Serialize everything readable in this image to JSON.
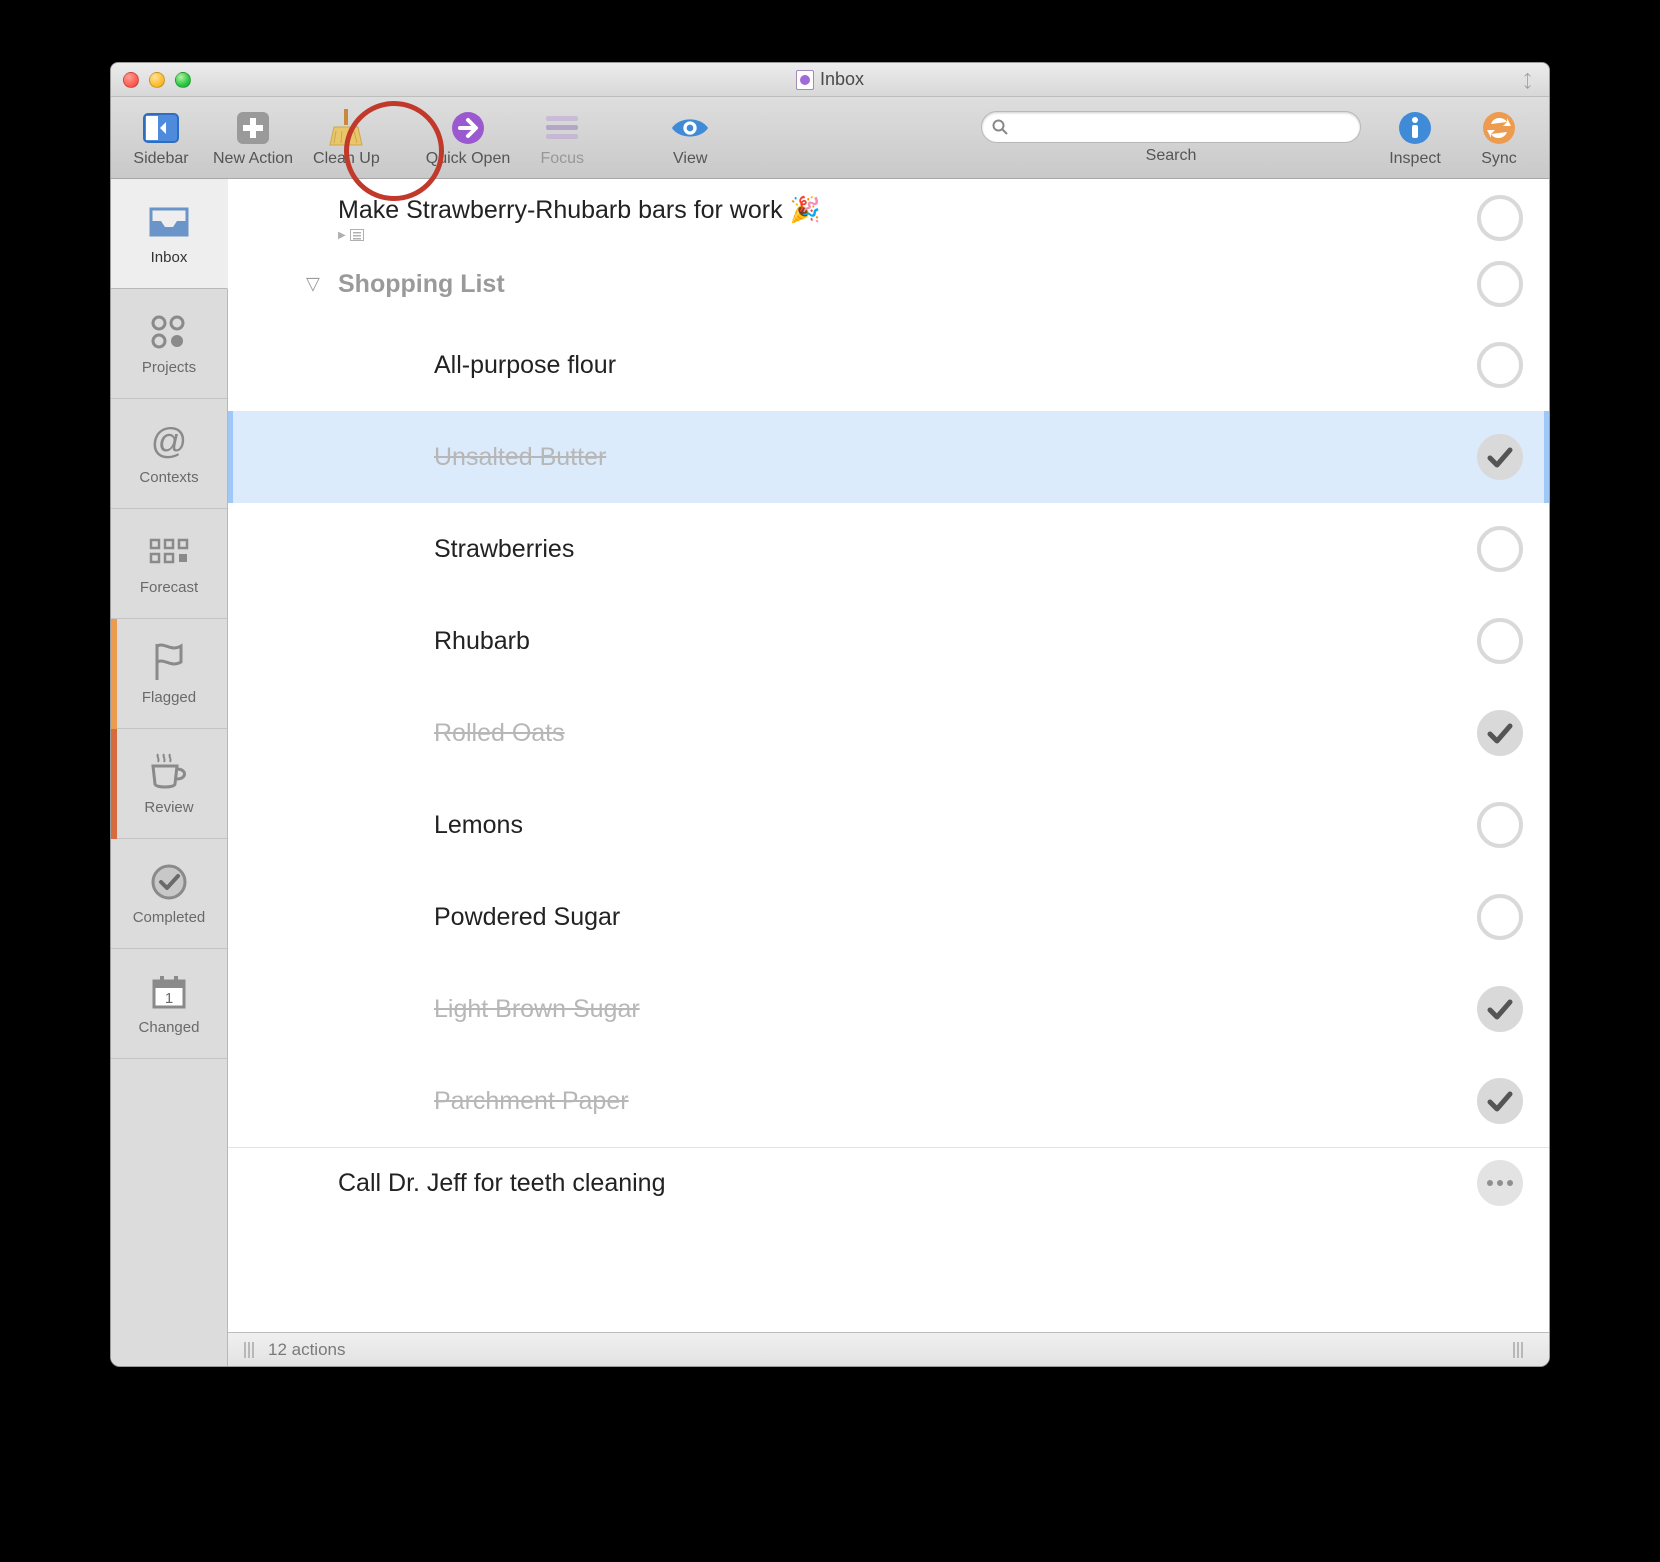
{
  "window": {
    "title": "Inbox"
  },
  "toolbar": {
    "sidebar": "Sidebar",
    "new_action": "New Action",
    "clean_up": "Clean Up",
    "quick_open": "Quick Open",
    "focus": "Focus",
    "view": "View",
    "search": "Search",
    "inspect": "Inspect",
    "sync": "Sync",
    "search_placeholder": ""
  },
  "sidebar": {
    "items": [
      {
        "label": "Inbox"
      },
      {
        "label": "Projects"
      },
      {
        "label": "Contexts"
      },
      {
        "label": "Forecast"
      },
      {
        "label": "Flagged"
      },
      {
        "label": "Review"
      },
      {
        "label": "Completed"
      },
      {
        "label": "Changed"
      }
    ]
  },
  "list": {
    "top_item": {
      "title": "Make Strawberry-Rhubarb bars for work 🎉"
    },
    "group": {
      "title": "Shopping List"
    },
    "items": [
      {
        "title": "All-purpose flour",
        "done": false
      },
      {
        "title": "Unsalted Butter",
        "done": true,
        "selected": true
      },
      {
        "title": "Strawberries",
        "done": false
      },
      {
        "title": "Rhubarb",
        "done": false
      },
      {
        "title": "Rolled Oats",
        "done": true
      },
      {
        "title": "Lemons",
        "done": false
      },
      {
        "title": "Powdered Sugar",
        "done": false
      },
      {
        "title": "Light Brown Sugar",
        "done": true
      },
      {
        "title": "Parchment Paper",
        "done": true
      }
    ],
    "bottom_item": {
      "title": "Call Dr. Jeff for teeth cleaning"
    }
  },
  "statusbar": {
    "count_label": "12 actions"
  }
}
